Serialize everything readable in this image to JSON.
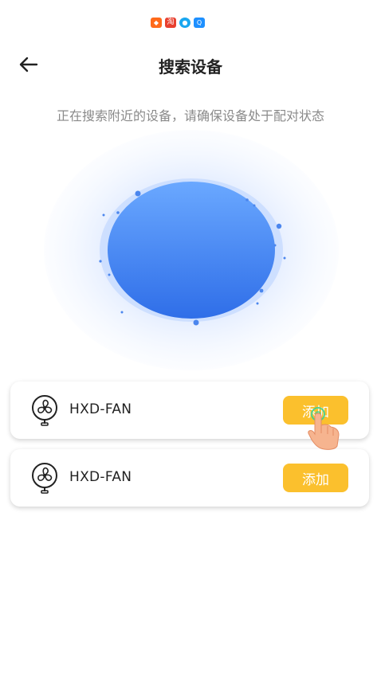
{
  "status_icons": [
    "orange-app-icon",
    "taobao-icon",
    "chat-icon",
    "search-app-icon"
  ],
  "status_icon_glyphs": [
    "◆",
    "淘",
    "●",
    "Q"
  ],
  "header": {
    "title": "搜索设备",
    "back_icon": "arrow-left-icon"
  },
  "subtitle": "正在搜索附近的设备，请确保设备处于配对状态",
  "colors": {
    "accent": "#fbc02d",
    "radar_blue": "#3a7ef0",
    "radar_light": "#e6f0ff"
  },
  "devices": [
    {
      "name": "HXD-FAN",
      "icon": "fan-icon",
      "action_label": "添加"
    },
    {
      "name": "HXD-FAN",
      "icon": "fan-icon",
      "action_label": "添加"
    }
  ]
}
